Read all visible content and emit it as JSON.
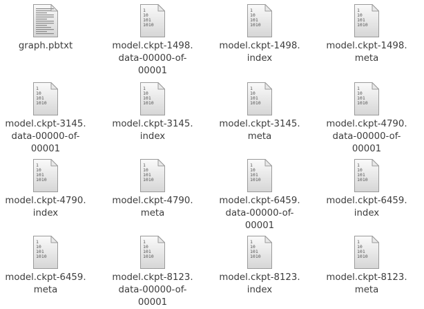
{
  "files": [
    {
      "name": [
        "graph.pbtxt"
      ],
      "icon": "text-file-icon"
    },
    {
      "name": [
        "model.ckpt-1498.",
        "data-00000-of-",
        "00001"
      ],
      "icon": "binary-file-icon"
    },
    {
      "name": [
        "model.ckpt-1498.",
        "index"
      ],
      "icon": "binary-file-icon"
    },
    {
      "name": [
        "model.ckpt-1498.",
        "meta"
      ],
      "icon": "binary-file-icon"
    },
    {
      "name": [
        "model.ckpt-3145.",
        "data-00000-of-",
        "00001"
      ],
      "icon": "binary-file-icon"
    },
    {
      "name": [
        "model.ckpt-3145.",
        "index"
      ],
      "icon": "binary-file-icon"
    },
    {
      "name": [
        "model.ckpt-3145.",
        "meta"
      ],
      "icon": "binary-file-icon"
    },
    {
      "name": [
        "model.ckpt-4790.",
        "data-00000-of-",
        "00001"
      ],
      "icon": "binary-file-icon"
    },
    {
      "name": [
        "model.ckpt-4790.",
        "index"
      ],
      "icon": "binary-file-icon"
    },
    {
      "name": [
        "model.ckpt-4790.",
        "meta"
      ],
      "icon": "binary-file-icon"
    },
    {
      "name": [
        "model.ckpt-6459.",
        "data-00000-of-",
        "00001"
      ],
      "icon": "binary-file-icon"
    },
    {
      "name": [
        "model.ckpt-6459.",
        "index"
      ],
      "icon": "binary-file-icon"
    },
    {
      "name": [
        "model.ckpt-6459.",
        "meta"
      ],
      "icon": "binary-file-icon"
    },
    {
      "name": [
        "model.ckpt-8123.",
        "data-00000-of-",
        "00001"
      ],
      "icon": "binary-file-icon"
    },
    {
      "name": [
        "model.ckpt-8123.",
        "index"
      ],
      "icon": "binary-file-icon"
    },
    {
      "name": [
        "model.ckpt-8123.",
        "meta"
      ],
      "icon": "binary-file-icon"
    }
  ],
  "binary_icon_text": [
    "1",
    "10",
    "101",
    "1010"
  ]
}
